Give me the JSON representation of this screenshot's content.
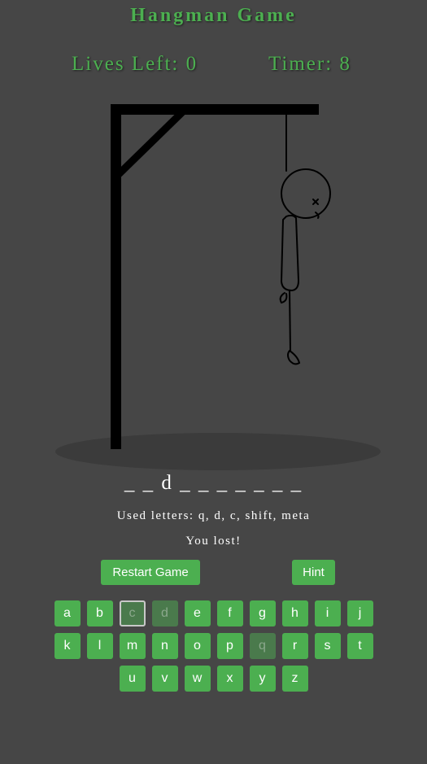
{
  "title": "Hangman Game",
  "stats": {
    "lives": "Lives Left: 0",
    "timer": "Timer: 8"
  },
  "word_display": "_ _ d _ _ _ _ _ _ _",
  "used_letters": "Used letters: q, d, c, shift, meta",
  "result": "You lost!",
  "buttons": {
    "restart": "Restart Game",
    "hint": "Hint"
  },
  "keyboard": {
    "rows": [
      [
        "a",
        "b",
        "c",
        "d",
        "e",
        "f",
        "g",
        "h",
        "i",
        "j"
      ],
      [
        "k",
        "l",
        "m",
        "n",
        "o",
        "p",
        "q",
        "r",
        "s",
        "t"
      ],
      [
        "u",
        "v",
        "w",
        "x",
        "y",
        "z"
      ]
    ],
    "used": [
      "c",
      "d",
      "q"
    ],
    "focused": "c"
  },
  "colors": {
    "background": "#464646",
    "accent": "#4caf50",
    "used_key": "#4a7a4c",
    "text": "#ffffff"
  }
}
